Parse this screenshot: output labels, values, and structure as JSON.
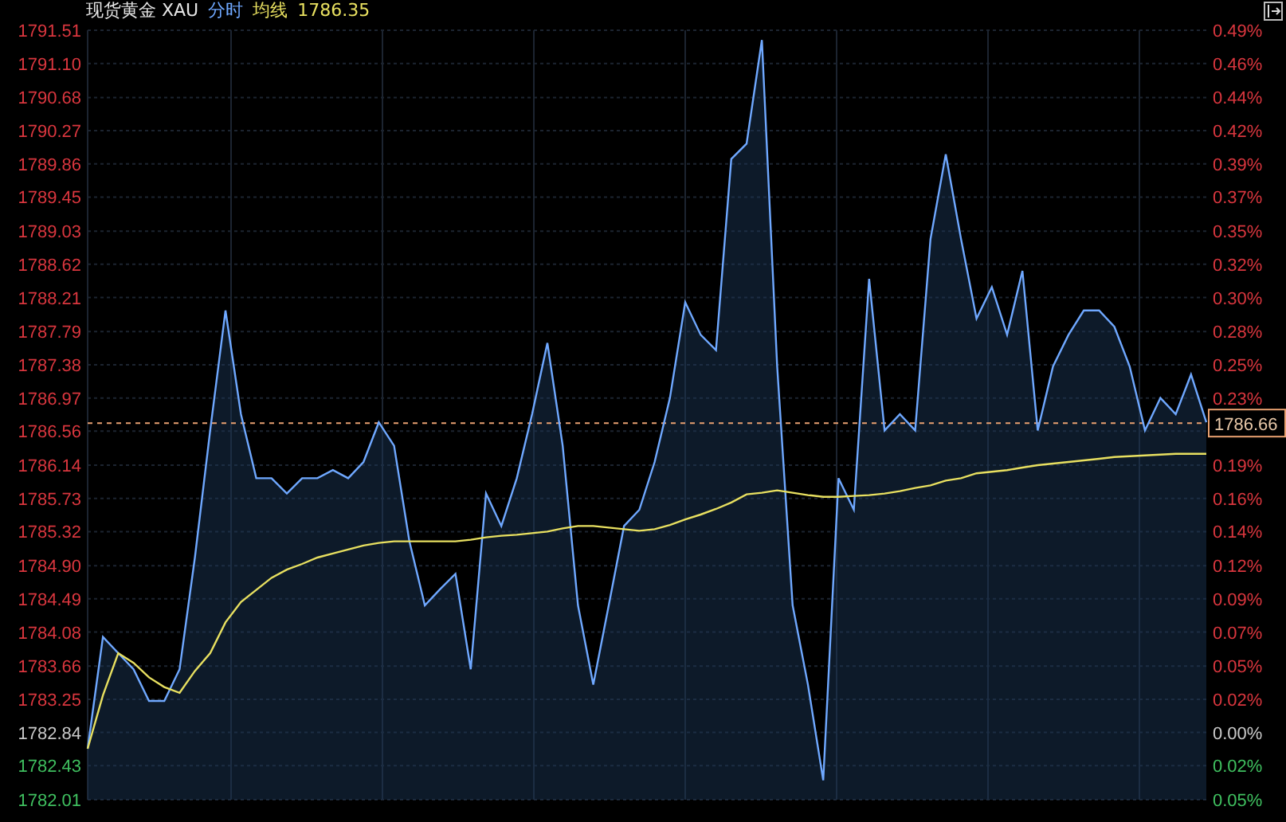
{
  "header": {
    "title": "现货黄金 XAU",
    "average_value": "1786.35"
  },
  "price_axis": [
    {
      "color": "#d9363e"
    },
    {
      "color": "#d9363e"
    },
    {
      "color": "#d9363e"
    },
    {
      "color": "#d9363e"
    },
    {
      "color": "#d9363e"
    },
    {
      "color": "#d9363e"
    },
    {
      "color": "#d9363e"
    },
    {
      "color": "#d9363e"
    },
    {
      "color": "#d9363e"
    },
    {
      "color": "#d9363e"
    },
    {
      "color": "#d9363e"
    },
    {
      "color": "#d9363e"
    },
    {
      "color": "#d9363e"
    },
    {
      "color": "#d9363e"
    },
    {
      "color": "#d9363e"
    },
    {
      "color": "#d9363e"
    },
    {
      "color": "#d9363e"
    },
    {
      "color": "#d9363e"
    },
    {
      "color": "#d9363e"
    },
    {
      "color": "#d9363e"
    },
    {
      "color": "#d9363e"
    },
    {
      "color": "#c8c8c8"
    },
    {
      "color": "#3fbf5f"
    },
    {
      "color": "#3fbf5f"
    }
  ],
  "chart_data": {
    "type": "area",
    "grid": true,
    "ylim": [
      1782.01,
      1791.51
    ],
    "ref_lines": [
      {
        "axis": "y",
        "value": 1786.66,
        "label": "1786.66",
        "color": "#e8a070"
      }
    ],
    "yticks": [
      {
        "value": 1791.51,
        "label": "1791.51"
      },
      {
        "value": 1791.1,
        "label": "1791.10"
      },
      {
        "value": 1790.68,
        "label": "1790.68"
      },
      {
        "value": 1790.27,
        "label": "1790.27"
      },
      {
        "value": 1789.86,
        "label": "1789.86"
      },
      {
        "value": 1789.45,
        "label": "1789.45"
      },
      {
        "value": 1789.03,
        "label": "1789.03"
      },
      {
        "value": 1788.62,
        "label": "1788.62"
      },
      {
        "value": 1788.21,
        "label": "1788.21"
      },
      {
        "value": 1787.79,
        "label": "1787.79"
      },
      {
        "value": 1787.38,
        "label": "1787.38"
      },
      {
        "value": 1786.97,
        "label": "1786.97"
      },
      {
        "value": 1786.56,
        "label": "1786.56"
      },
      {
        "value": 1786.14,
        "label": "1786.14"
      },
      {
        "value": 1785.73,
        "label": "1785.73"
      },
      {
        "value": 1785.32,
        "label": "1785.32"
      },
      {
        "value": 1784.9,
        "label": "1784.90"
      },
      {
        "value": 1784.49,
        "label": "1784.49"
      },
      {
        "value": 1784.08,
        "label": "1784.08"
      },
      {
        "value": 1783.66,
        "label": "1783.66"
      },
      {
        "value": 1783.25,
        "label": "1783.25"
      },
      {
        "value": 1782.84,
        "label": "1782.84"
      },
      {
        "value": 1782.43,
        "label": "1782.43"
      },
      {
        "value": 1782.01,
        "label": "1782.01"
      }
    ],
    "series": [
      {
        "name": "分时",
        "type": "area",
        "color": "#6fa8ff",
        "values": [
          1782.64,
          1784.02,
          1783.82,
          1783.62,
          1783.23,
          1783.23,
          1783.62,
          1785.0,
          1786.57,
          1788.05,
          1786.77,
          1785.98,
          1785.98,
          1785.79,
          1785.98,
          1785.98,
          1786.08,
          1785.98,
          1786.18,
          1786.67,
          1786.38,
          1785.2,
          1784.41,
          1784.61,
          1784.8,
          1783.62,
          1785.79,
          1785.39,
          1785.98,
          1786.77,
          1787.65,
          1786.38,
          1784.41,
          1783.43,
          1784.41,
          1785.39,
          1785.59,
          1786.18,
          1786.97,
          1788.15,
          1787.75,
          1787.56,
          1789.92,
          1790.11,
          1791.39,
          1787.36,
          1784.41,
          1783.43,
          1782.25,
          1785.98,
          1785.59,
          1788.44,
          1786.57,
          1786.77,
          1786.57,
          1788.93,
          1789.98,
          1788.93,
          1787.95,
          1788.34,
          1787.75,
          1788.54,
          1786.57,
          1787.36,
          1787.75,
          1788.05,
          1788.05,
          1787.85,
          1787.36,
          1786.57,
          1786.97,
          1786.77,
          1787.26,
          1786.67
        ]
      },
      {
        "name": "均线",
        "type": "line",
        "color": "#e8e060",
        "values": [
          1782.64,
          1783.3,
          1783.82,
          1783.7,
          1783.52,
          1783.4,
          1783.33,
          1783.6,
          1783.82,
          1784.2,
          1784.45,
          1784.6,
          1784.75,
          1784.85,
          1784.92,
          1785.0,
          1785.05,
          1785.1,
          1785.15,
          1785.18,
          1785.2,
          1785.2,
          1785.2,
          1785.2,
          1785.2,
          1785.22,
          1785.25,
          1785.27,
          1785.28,
          1785.3,
          1785.32,
          1785.36,
          1785.39,
          1785.39,
          1785.37,
          1785.35,
          1785.33,
          1785.35,
          1785.4,
          1785.47,
          1785.53,
          1785.6,
          1785.68,
          1785.78,
          1785.8,
          1785.83,
          1785.8,
          1785.77,
          1785.75,
          1785.75,
          1785.76,
          1785.77,
          1785.79,
          1785.82,
          1785.86,
          1785.89,
          1785.95,
          1785.98,
          1786.04,
          1786.06,
          1786.08,
          1786.11,
          1786.14,
          1786.16,
          1786.18,
          1786.2,
          1786.22,
          1786.24,
          1786.25,
          1786.26,
          1786.27,
          1786.28,
          1786.28,
          1786.28
        ]
      }
    ]
  },
  "right_axis": [
    {
      "kind": "percent",
      "label": "0.49%",
      "color": "#d9363e"
    },
    {
      "kind": "percent",
      "label": "0.46%",
      "color": "#d9363e"
    },
    {
      "kind": "percent",
      "label": "0.44%",
      "color": "#d9363e"
    },
    {
      "kind": "percent",
      "label": "0.42%",
      "color": "#d9363e"
    },
    {
      "kind": "percent",
      "label": "0.39%",
      "color": "#d9363e"
    },
    {
      "kind": "percent",
      "label": "0.37%",
      "color": "#d9363e"
    },
    {
      "kind": "percent",
      "label": "0.35%",
      "color": "#d9363e"
    },
    {
      "kind": "percent",
      "label": "0.32%",
      "color": "#d9363e"
    },
    {
      "kind": "percent",
      "label": "0.30%",
      "color": "#d9363e"
    },
    {
      "kind": "percent",
      "label": "0.28%",
      "color": "#d9363e"
    },
    {
      "kind": "percent",
      "label": "0.25%",
      "color": "#d9363e"
    },
    {
      "kind": "percent",
      "label": "0.23%",
      "color": "#d9363e"
    },
    {
      "kind": "percent",
      "label": "0.19%",
      "color": "#d9363e"
    },
    {
      "kind": "percent",
      "label": "0.16%",
      "color": "#d9363e"
    },
    {
      "kind": "percent",
      "label": "0.14%",
      "color": "#d9363e"
    },
    {
      "kind": "percent",
      "label": "0.12%",
      "color": "#d9363e"
    },
    {
      "kind": "percent",
      "label": "0.09%",
      "color": "#d9363e"
    },
    {
      "kind": "percent",
      "label": "0.07%",
      "color": "#d9363e"
    },
    {
      "kind": "percent",
      "label": "0.05%",
      "color": "#d9363e"
    },
    {
      "kind": "percent",
      "label": "0.02%",
      "color": "#d9363e"
    },
    {
      "kind": "percent",
      "label": "0.00%",
      "color": "#c8c8c8"
    },
    {
      "kind": "percent",
      "label": "0.02%",
      "color": "#3fbf5f"
    },
    {
      "kind": "percent",
      "label": "0.05%",
      "color": "#3fbf5f"
    }
  ]
}
